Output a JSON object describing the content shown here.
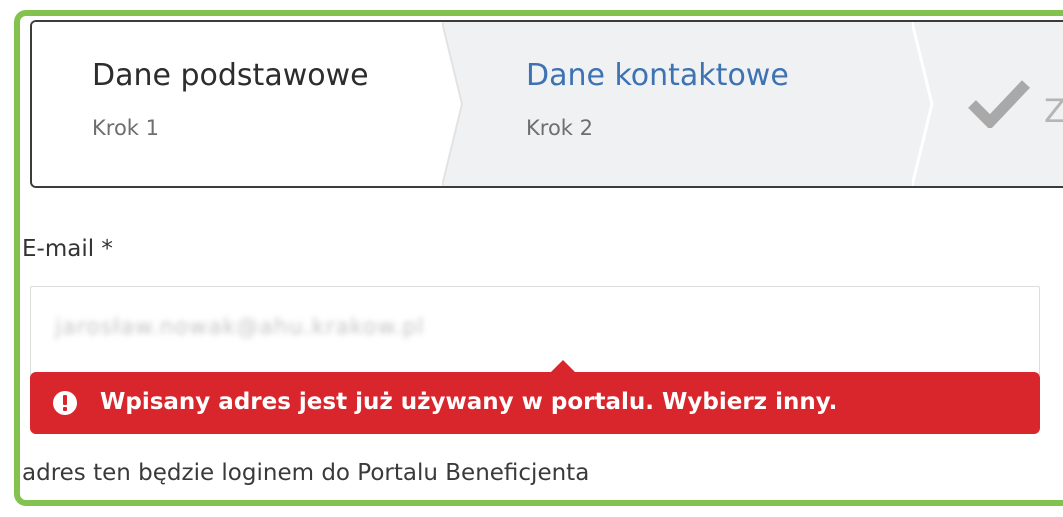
{
  "steps": [
    {
      "title": "Dane podstawowe",
      "subtitle": "Krok 1",
      "state": "completed"
    },
    {
      "title": "Dane kontaktowe",
      "subtitle": "Krok 2",
      "state": "active"
    },
    {
      "title": "Z",
      "icon": "check-icon",
      "state": "upcoming"
    }
  ],
  "email": {
    "label": "E-mail *",
    "value": "jarosław.nowak@ahu.krakow.pl"
  },
  "error": {
    "icon": "exclamation-circle-icon",
    "message": "Wpisany adres jest już używany w portalu. Wybierz inny."
  },
  "hint": "adres ten będzie loginem do Portalu Beneficjenta",
  "colors": {
    "frame": "#84c24f",
    "active_step": "#3d72b3",
    "error_bg": "#d9262c"
  }
}
